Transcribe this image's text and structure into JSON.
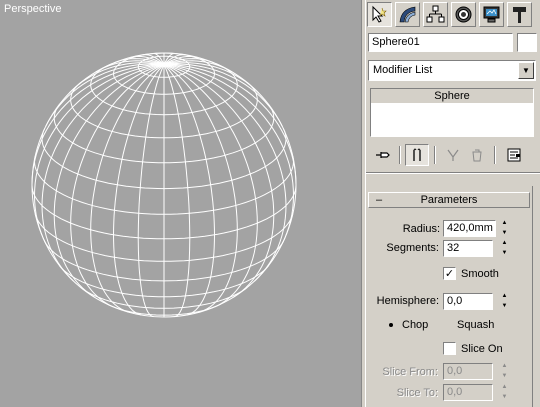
{
  "viewport": {
    "label": "Perspective",
    "background": "#a3a3a3",
    "wire_color": "#ffffff"
  },
  "command_panel": {
    "tabs": [
      {
        "icon": "create-cursor-icon",
        "active": true
      },
      {
        "icon": "modify-arc-icon",
        "active": false
      },
      {
        "icon": "hierarchy-icon",
        "active": false
      },
      {
        "icon": "motion-icon",
        "active": false
      },
      {
        "icon": "display-icon",
        "active": false
      },
      {
        "icon": "utilities-hammer-icon",
        "active": false
      }
    ],
    "object_name": "Sphere01",
    "object_color": "#ffffff",
    "modifier_list": "Modifier List",
    "stack_items": [
      "Sphere"
    ],
    "stack_tools": [
      "pin-stack-icon",
      "show-end-result-icon",
      "make-unique-icon",
      "remove-modifier-icon",
      "configure-sets-icon"
    ]
  },
  "parameters": {
    "title": "Parameters",
    "collapse_glyph": "–",
    "radius_label": "Radius:",
    "radius_value": "420,0mm",
    "segments_label": "Segments:",
    "segments_value": "32",
    "smooth_label": "Smooth",
    "smooth_checked": true,
    "hemisphere_label": "Hemisphere:",
    "hemisphere_value": "0,0",
    "chop_label": "Chop",
    "squash_label": "Squash",
    "selected_mode": "Chop",
    "slice_on_label": "Slice On",
    "slice_on_checked": false,
    "slice_from_label": "Slice From:",
    "slice_from_value": "0,0",
    "slice_to_label": "Slice To:",
    "slice_to_value": "0,0"
  }
}
